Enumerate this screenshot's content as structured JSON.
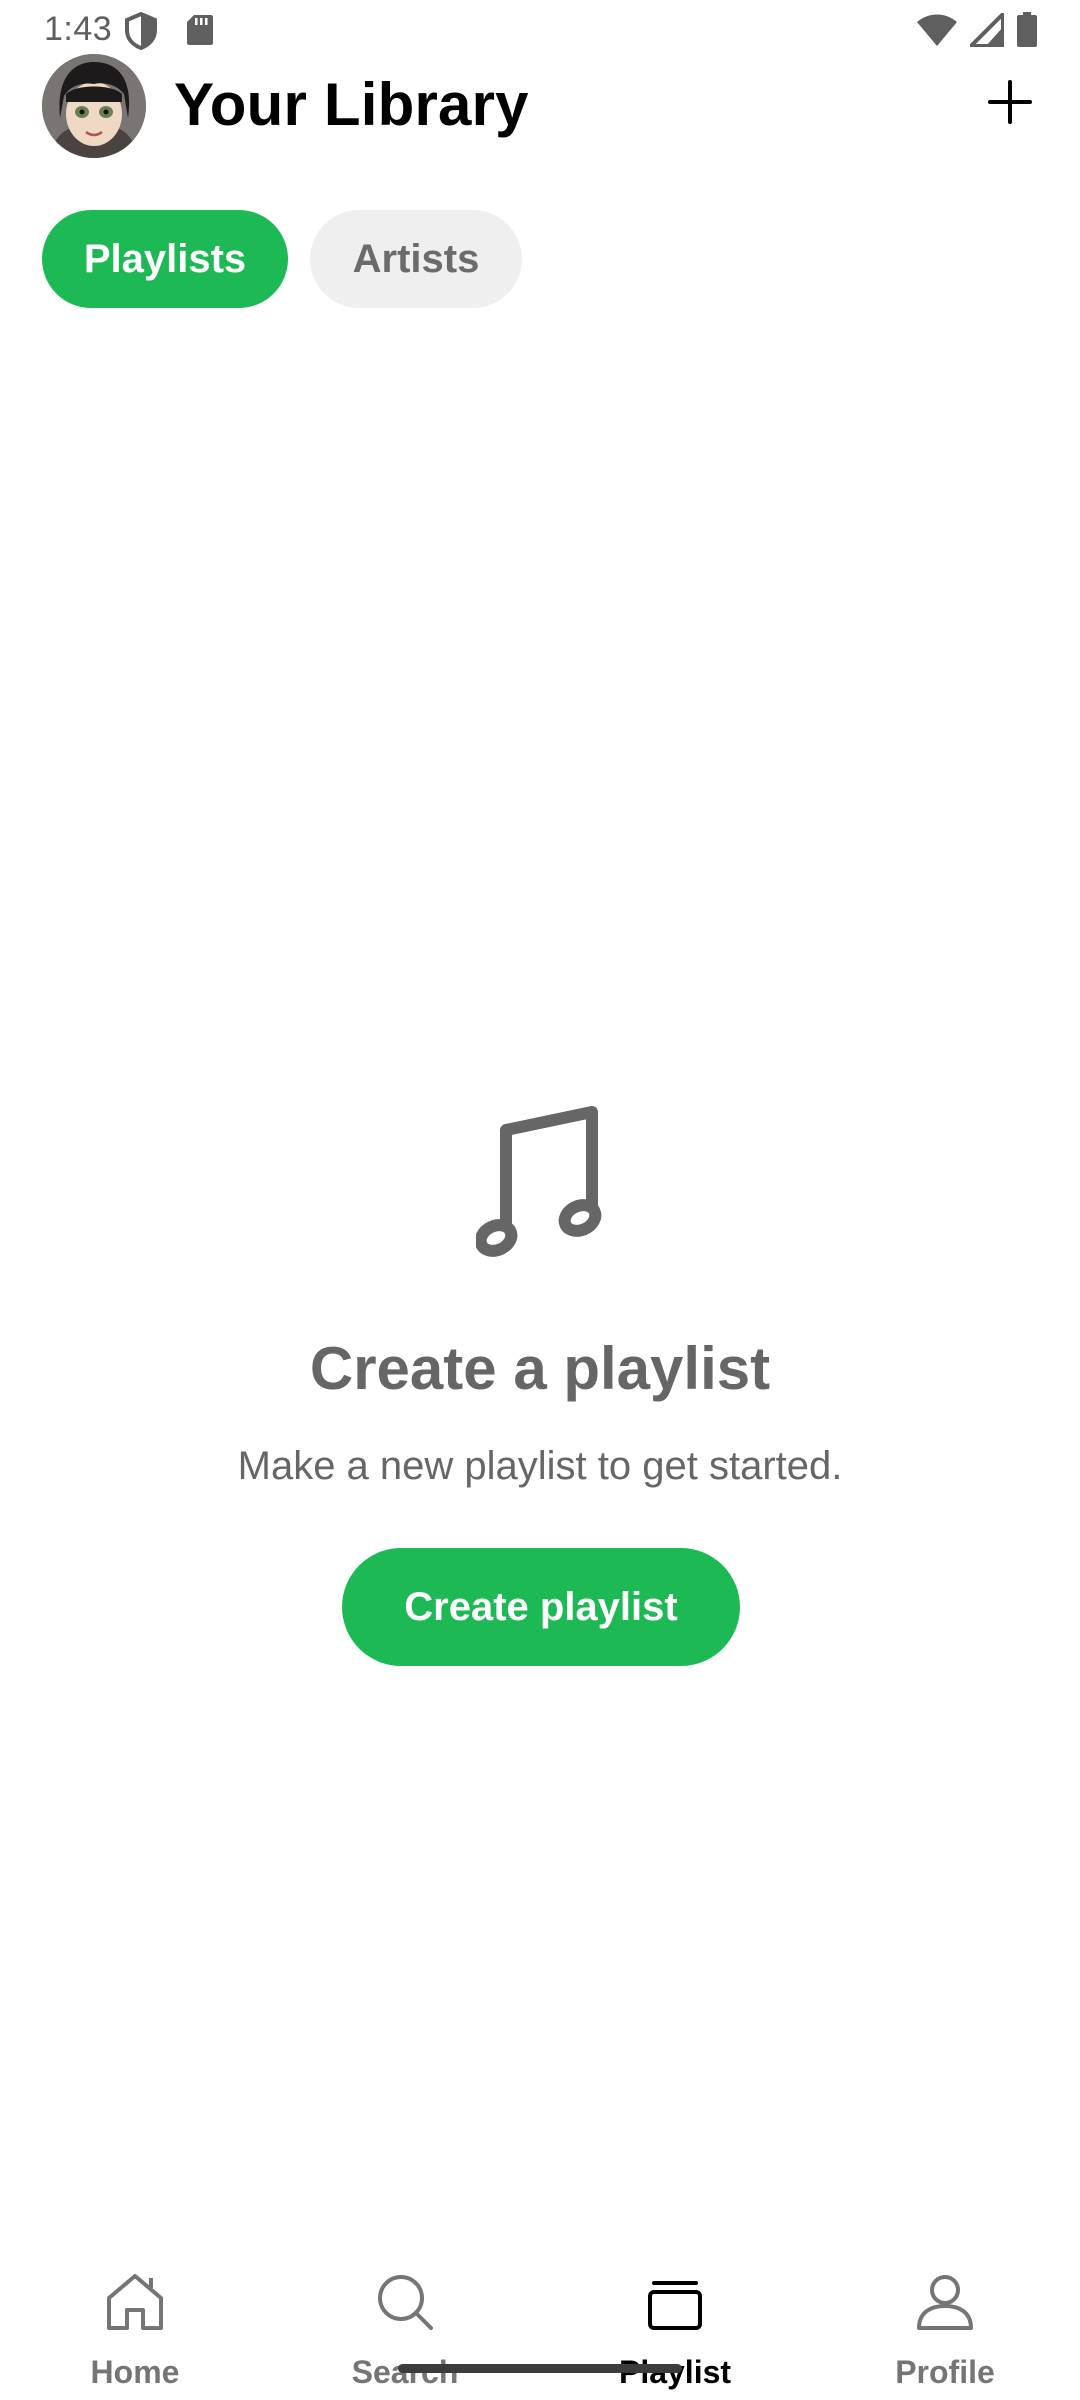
{
  "status_bar": {
    "time": "1:43",
    "icons": [
      "shield-icon",
      "sd-card-icon",
      "wifi-icon",
      "signal-icon",
      "battery-icon"
    ]
  },
  "header": {
    "title": "Your Library",
    "avatar": "user-avatar",
    "add_icon": "plus-icon"
  },
  "filters": {
    "chips": [
      {
        "label": "Playlists",
        "selected": true
      },
      {
        "label": "Artists",
        "selected": false
      }
    ]
  },
  "empty_state": {
    "icon": "music-note-icon",
    "title": "Create a playlist",
    "subtitle": "Make a new playlist to get started.",
    "button_label": "Create playlist"
  },
  "bottom_nav": {
    "items": [
      {
        "label": "Home",
        "icon": "home-icon",
        "active": false
      },
      {
        "label": "Search",
        "icon": "search-icon",
        "active": false
      },
      {
        "label": "Playlist",
        "icon": "playlist-icon",
        "active": true
      },
      {
        "label": "Profile",
        "icon": "profile-icon",
        "active": false
      }
    ]
  },
  "colors": {
    "accent": "#1db954",
    "chip_inactive_bg": "#efefef",
    "text_muted": "#666666"
  }
}
